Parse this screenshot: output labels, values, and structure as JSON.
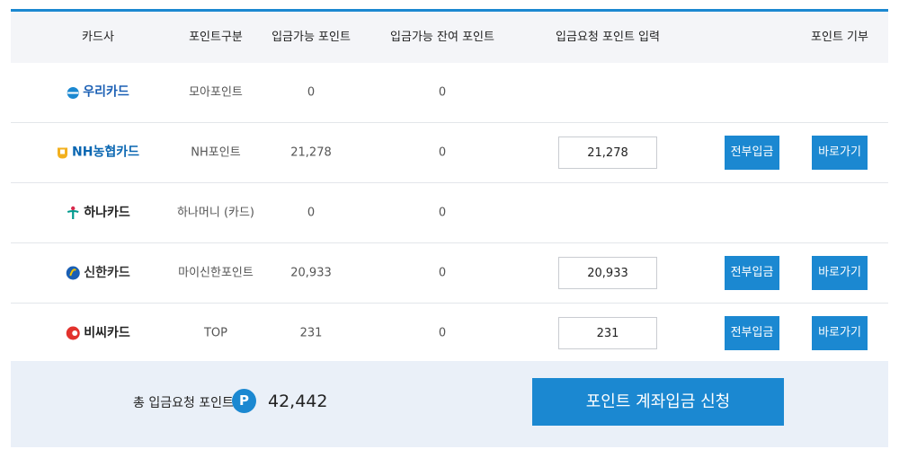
{
  "headers": [
    "카드사",
    "포인트구분",
    "입금가능 포인트",
    "입금가능 잔여 포인트",
    "입금요청 포인트 입력",
    "포인트 기부"
  ],
  "rows": [
    {
      "card": "우리카드",
      "logo": "woori-logo",
      "point_type": "모아포인트",
      "available": "0",
      "remaining": "0",
      "input": null
    },
    {
      "card": "NH농협카드",
      "logo": "nh-logo",
      "point_type": "NH포인트",
      "available": "21,278",
      "remaining": "0",
      "input": "21,278",
      "all_label": "전부입금",
      "go_label": "바로가기"
    },
    {
      "card": "하나카드",
      "logo": "hana-logo",
      "point_type": "하나머니 (카드)",
      "available": "0",
      "remaining": "0",
      "input": null
    },
    {
      "card": "신한카드",
      "logo": "shinhan-logo",
      "point_type": "마이신한포인트",
      "available": "20,933",
      "remaining": "0",
      "input": "20,933",
      "all_label": "전부입금",
      "go_label": "바로가기"
    },
    {
      "card": "비씨카드",
      "logo": "bc-logo",
      "point_type": "TOP",
      "available": "231",
      "remaining": "0",
      "input": "231",
      "all_label": "전부입금",
      "go_label": "바로가기"
    }
  ],
  "summary": {
    "label": "총 입금요청 포인트",
    "badge": "P",
    "value": "42,442"
  },
  "submit_label": "포인트 계좌입금 신청",
  "colors": {
    "accent": "#1b88d1",
    "header_bg": "#f4f5f8",
    "footer_bg": "#eaf0f8"
  }
}
